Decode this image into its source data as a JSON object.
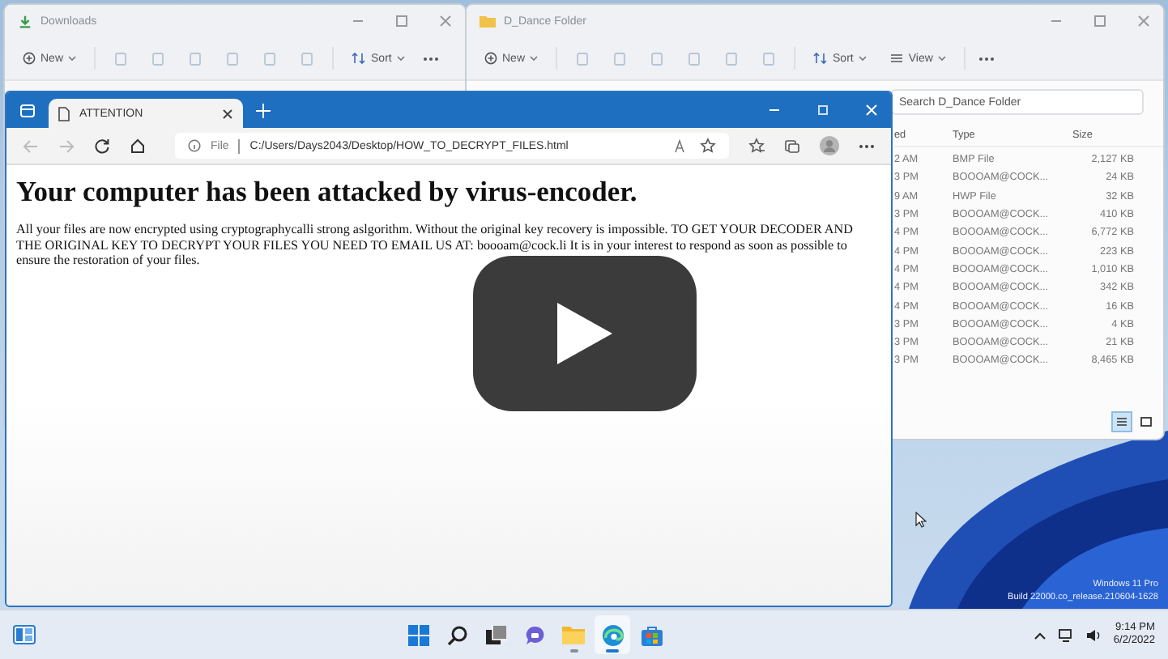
{
  "downloads_window": {
    "title": "Downloads",
    "toolbar": [
      {
        "kind": "new",
        "label": "New"
      },
      {
        "kind": "sort",
        "label": "Sort"
      }
    ]
  },
  "folder_window": {
    "title": "D_Dance Folder",
    "toolbar": [
      {
        "kind": "new",
        "label": "New"
      },
      {
        "kind": "sort",
        "label": "Sort"
      },
      {
        "kind": "view",
        "label": "View"
      }
    ],
    "search": {
      "placeholder": "Search D_Dance Folder"
    },
    "columns": [
      "ed",
      "Type",
      "Size"
    ],
    "rows": [
      [
        "2 AM",
        "BMP File",
        "2,127 KB"
      ],
      [
        "3 PM",
        "BOOOAM@COCK...",
        "24 KB"
      ],
      [
        "9 AM",
        "HWP File",
        "32 KB"
      ],
      [
        "3 PM",
        "BOOOAM@COCK...",
        "410 KB"
      ],
      [
        "4 PM",
        "BOOOAM@COCK...",
        "6,772 KB"
      ],
      [
        "4 PM",
        "BOOOAM@COCK...",
        "223 KB"
      ],
      [
        "4 PM",
        "BOOOAM@COCK...",
        "1,010 KB"
      ],
      [
        "4 PM",
        "BOOOAM@COCK...",
        "342 KB"
      ],
      [
        "4 PM",
        "BOOOAM@COCK...",
        "16 KB"
      ],
      [
        "3 PM",
        "BOOOAM@COCK...",
        "4 KB"
      ],
      [
        "3 PM",
        "BOOOAM@COCK...",
        "21 KB"
      ],
      [
        "3 PM",
        "BOOOAM@COCK...",
        "8,465 KB"
      ]
    ],
    "views": [
      {
        "kind": "details",
        "selected": true
      },
      {
        "kind": "tiles",
        "selected": false
      }
    ]
  },
  "browser": {
    "tab": "ATTENTION",
    "address_prefix": "File",
    "url": "C:/Users/Days2043/Desktop/HOW_TO_DECRYPT_FILES.html",
    "heading": "Your computer has been attacked by virus-encoder.",
    "paragraph": "All your files are now encrypted using cryptographycalli strong aslgorithm. Without the original key recovery is impossible. TO GET YOUR DECODER AND THE ORIGINAL KEY TO DECRYPT YOUR FILES YOU NEED TO EMAIL US AT: boooam@cock.li It is in your interest to respond as soon as possible to ensure the restoration of your files."
  },
  "desktop_watermark": [
    "Windows 11 Pro",
    "Build 22000.co_release.210604-1628"
  ],
  "taskbar": {
    "apps": [
      {
        "kind": "start",
        "running": false,
        "selected": false
      },
      {
        "kind": "search",
        "running": false,
        "selected": false
      },
      {
        "kind": "taskview",
        "running": false,
        "selected": false
      },
      {
        "kind": "chat",
        "running": false,
        "selected": false
      },
      {
        "kind": "explorer",
        "running": true,
        "selected": false
      },
      {
        "kind": "edge",
        "running": true,
        "selected": true
      },
      {
        "kind": "store",
        "running": false,
        "selected": false
      }
    ],
    "time": "9:14 PM",
    "date": "6/2/2022"
  }
}
